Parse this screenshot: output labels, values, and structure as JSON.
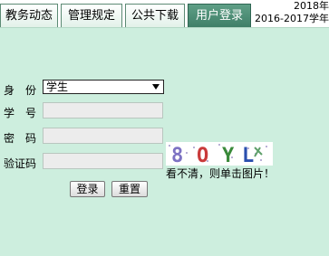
{
  "tabs": [
    {
      "label": "教务动态"
    },
    {
      "label": "管理规定"
    },
    {
      "label": "公共下载"
    },
    {
      "label": "用户登录",
      "active": true
    }
  ],
  "year": {
    "line1": "2018年",
    "line2": "2016-2017学年"
  },
  "form": {
    "identity_label": "身　份",
    "identity_value": "学生",
    "id_label": "学　号",
    "id_value": "",
    "password_label": "密　码",
    "password_value": "",
    "captcha_label": "验证码",
    "captcha_value": "",
    "captcha_text": "8OYL",
    "captcha_hint": "看不清，则单击图片！",
    "login_label": "登录",
    "reset_label": "重置"
  },
  "colors": {
    "background": "#cdeede",
    "active_tab": "#3f7f68"
  }
}
